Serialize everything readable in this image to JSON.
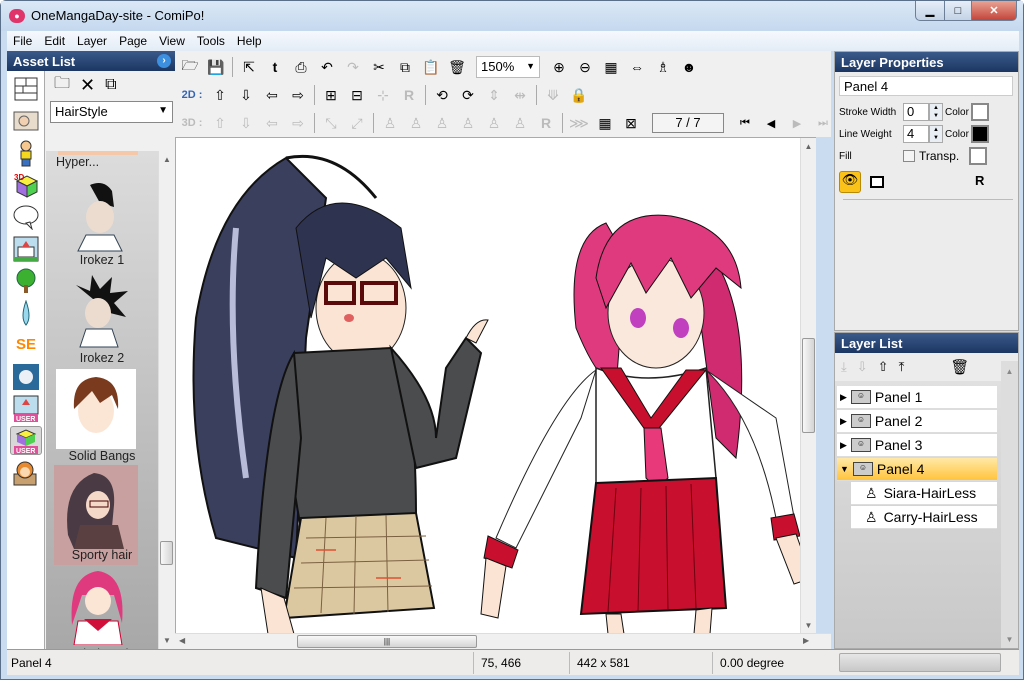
{
  "window": {
    "title": "OneMangaDay-site - ComiPo!",
    "app_icon": "comipo-logo-icon",
    "controls": [
      "minimize",
      "maximize",
      "close"
    ]
  },
  "menu": [
    "File",
    "Edit",
    "Layer",
    "Page",
    "View",
    "Tools",
    "Help"
  ],
  "asset_list": {
    "title": "Asset List",
    "tabs": [
      "panel-layout",
      "background-image",
      "character",
      "3d-object",
      "speech-balloon",
      "background-3d",
      "tree",
      "drop",
      "se-text",
      "effect",
      "user-background",
      "user-3d-object",
      "user-character"
    ],
    "selected_tab": "user-3d-object",
    "tools": [
      "open-folder",
      "delete",
      "copy-to-folder"
    ],
    "category": "HairStyle",
    "items": [
      {
        "label": "Hyper...",
        "selected": false
      },
      {
        "label": "Irokez 1",
        "selected": false
      },
      {
        "label": "Irokez 2",
        "selected": false
      },
      {
        "label": "Solid Bangs",
        "selected": false
      },
      {
        "label": "Sporty hair",
        "selected": true
      },
      {
        "label": "Windy Hair",
        "selected": false
      }
    ]
  },
  "toolbar": {
    "zoom": "150%",
    "label_2d": "2D :",
    "label_3d": "3D :",
    "page_indicator": "7 / 7"
  },
  "canvas": {
    "characters": [
      {
        "name": "Siara-HairLess",
        "hair": "Sporty hair",
        "hair_color": "#3a3f5e",
        "top_color": "#4a4c4e",
        "skirt": "beige plaid"
      },
      {
        "name": "Carry-HairLess",
        "hair": "Windy Hair",
        "hair_color": "#e0357a",
        "top_color": "#ffffff",
        "skirt_color": "#cc1030"
      }
    ]
  },
  "layer_properties": {
    "title": "Layer Properties",
    "name_value": "Panel 4",
    "stroke_width_label": "Stroke Width",
    "stroke_width": "0",
    "line_weight_label": "Line Weight",
    "line_weight": "4",
    "color_label": "Color",
    "stroke_color": "#ffffff",
    "line_color": "#000000",
    "fill_label": "Fill",
    "transp_label": "Transp.",
    "transp_checked": false,
    "fill_color": "#ffffff"
  },
  "layer_list": {
    "title": "Layer List",
    "tools": [
      "move-bottom",
      "move-down",
      "move-up",
      "move-top",
      "delete"
    ],
    "items": [
      {
        "label": "Panel 1",
        "expanded": false,
        "selected": false
      },
      {
        "label": "Panel 2",
        "expanded": false,
        "selected": false
      },
      {
        "label": "Panel 3",
        "expanded": false,
        "selected": false
      },
      {
        "label": "Panel 4",
        "expanded": true,
        "selected": true
      },
      {
        "label": "Siara-HairLess",
        "child": true
      },
      {
        "label": "Carry-HairLess",
        "child": true
      }
    ]
  },
  "status": {
    "layer": "Panel 4",
    "cursor": "75, 466",
    "size": "442 x 581",
    "rotation": "0.00 degree"
  },
  "colors": {
    "accent_header": "#1c3662",
    "selection": "#ffc43c",
    "label_2d": "#3566b5"
  }
}
